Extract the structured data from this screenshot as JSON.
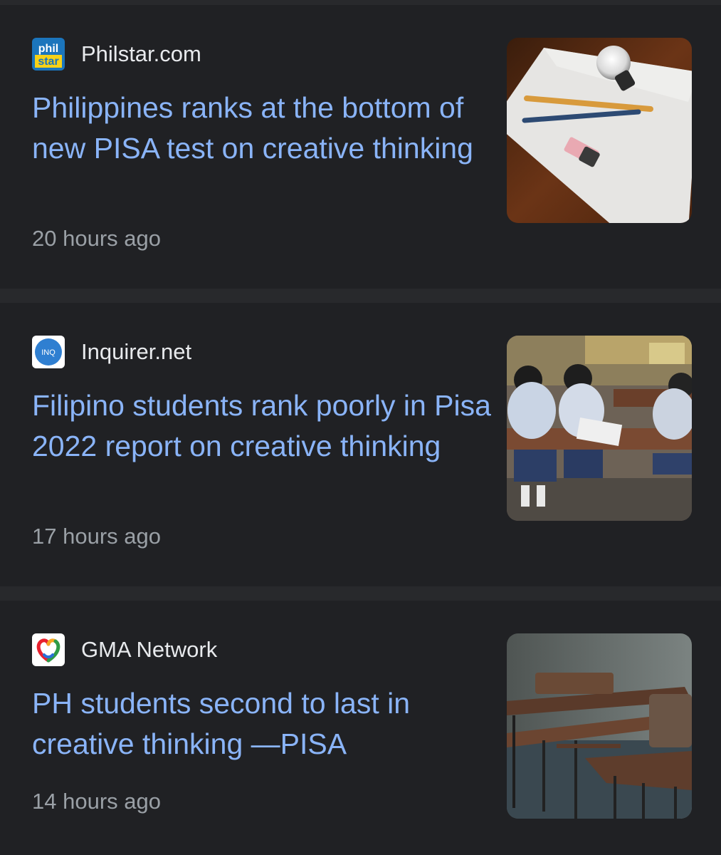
{
  "articles": [
    {
      "source": "Philstar.com",
      "favicon_icon": "philstar-logo-icon",
      "favicon_text": [
        "phil",
        "star"
      ],
      "headline": "Philippines ranks at the bottom of new PISA test on creative thinking",
      "time": "20 hours ago",
      "thumbnail": "lightbulb-pencils-paper-image"
    },
    {
      "source": "Inquirer.net",
      "favicon_icon": "inquirer-logo-icon",
      "favicon_text": "INQ",
      "headline": "Filipino students rank poorly in Pisa 2022 report on creative thinking",
      "time": "17 hours ago",
      "thumbnail": "students-classroom-image"
    },
    {
      "source": "GMA Network",
      "favicon_icon": "gma-network-logo-icon",
      "headline": "PH students second to last in creative thinking —PISA",
      "time": "14 hours ago",
      "thumbnail": "empty-classroom-desks-image"
    }
  ],
  "colors": {
    "background": "#202124",
    "separator": "#28292c",
    "headline": "#8ab4f8",
    "source": "#e8eaed",
    "time": "#9aa0a6"
  }
}
